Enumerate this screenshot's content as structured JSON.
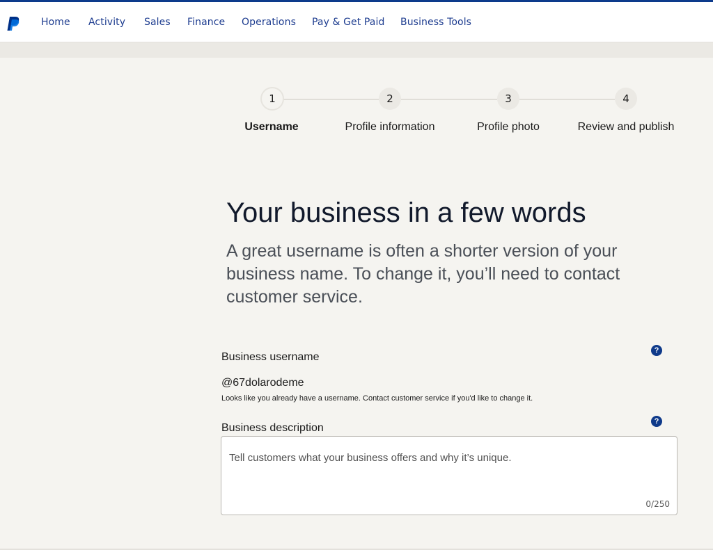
{
  "nav": {
    "brand_color": "#0d3b8c",
    "items": [
      "Home",
      "Activity",
      "Sales",
      "Finance",
      "Operations",
      "Pay & Get Paid",
      "Business Tools"
    ]
  },
  "stepper": {
    "current_step": 1,
    "steps": [
      {
        "number": "1",
        "label": "Username"
      },
      {
        "number": "2",
        "label": "Profile information"
      },
      {
        "number": "3",
        "label": "Profile photo"
      },
      {
        "number": "4",
        "label": "Review and publish"
      }
    ]
  },
  "main": {
    "title": "Your business in a few words",
    "subtitle": "A great username is often a shorter version of your business name. To change it, you’ll need to contact customer service."
  },
  "username_field": {
    "label": "Business username",
    "value": "@67dolarodeme",
    "hint": "Looks like you already have a username. Contact customer service if you'd like to change it.",
    "help_icon": "?"
  },
  "description_field": {
    "label": "Business description",
    "placeholder": "Tell customers what your business offers and why it’s unique.",
    "counter": "0/250",
    "help_icon": "?"
  }
}
